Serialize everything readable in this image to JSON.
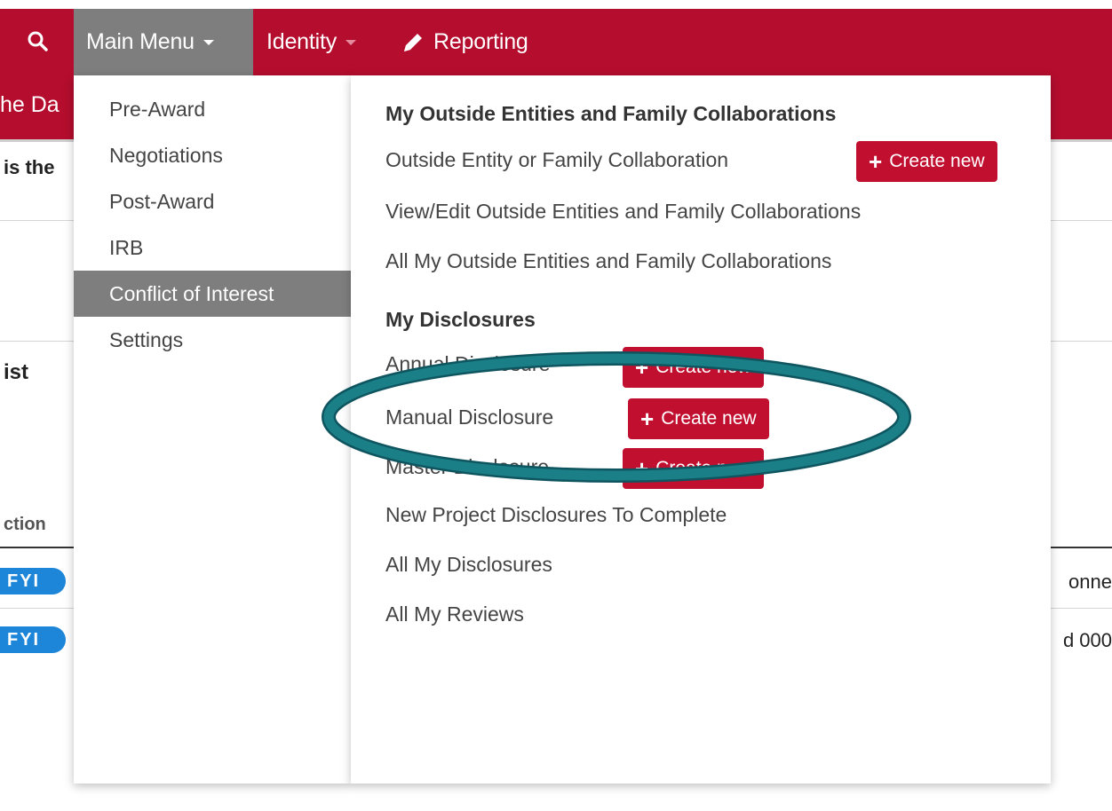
{
  "nav": {
    "main_menu": "Main Menu",
    "identity": "Identity",
    "reporting": "Reporting"
  },
  "background": {
    "header_fragment": "he Da",
    "text_fragment_1": "is the",
    "text_fragment_2": "ist",
    "column_fragment": "ction",
    "badge_1": "FYI",
    "badge_2": "FYI",
    "row_1_fragment": "onne",
    "row_2_fragment": "d 000"
  },
  "menu": {
    "left_items": [
      {
        "label": "Pre-Award"
      },
      {
        "label": "Negotiations"
      },
      {
        "label": "Post-Award"
      },
      {
        "label": "IRB"
      },
      {
        "label": "Conflict of Interest"
      },
      {
        "label": "Settings"
      }
    ],
    "section_1": {
      "heading": "My Outside Entities and Family Collaborations",
      "links": [
        "Outside Entity or Family Collaboration",
        "View/Edit Outside Entities and Family Collaborations",
        "All My Outside Entities and Family Collaborations"
      ]
    },
    "section_2": {
      "heading": "My Disclosures",
      "links": [
        "Annual Disclosure",
        "Manual Disclosure",
        "Master Disclosure",
        "New Project Disclosures To Complete",
        "All My Disclosures",
        "All My Reviews"
      ]
    },
    "create_new_label": "Create new"
  },
  "colors": {
    "brand_red": "#b50d2e",
    "active_gray": "#7e7e7e",
    "button_red": "#c10f30",
    "annotation_teal": "#1a7f86",
    "badge_blue": "#1e86d8"
  }
}
